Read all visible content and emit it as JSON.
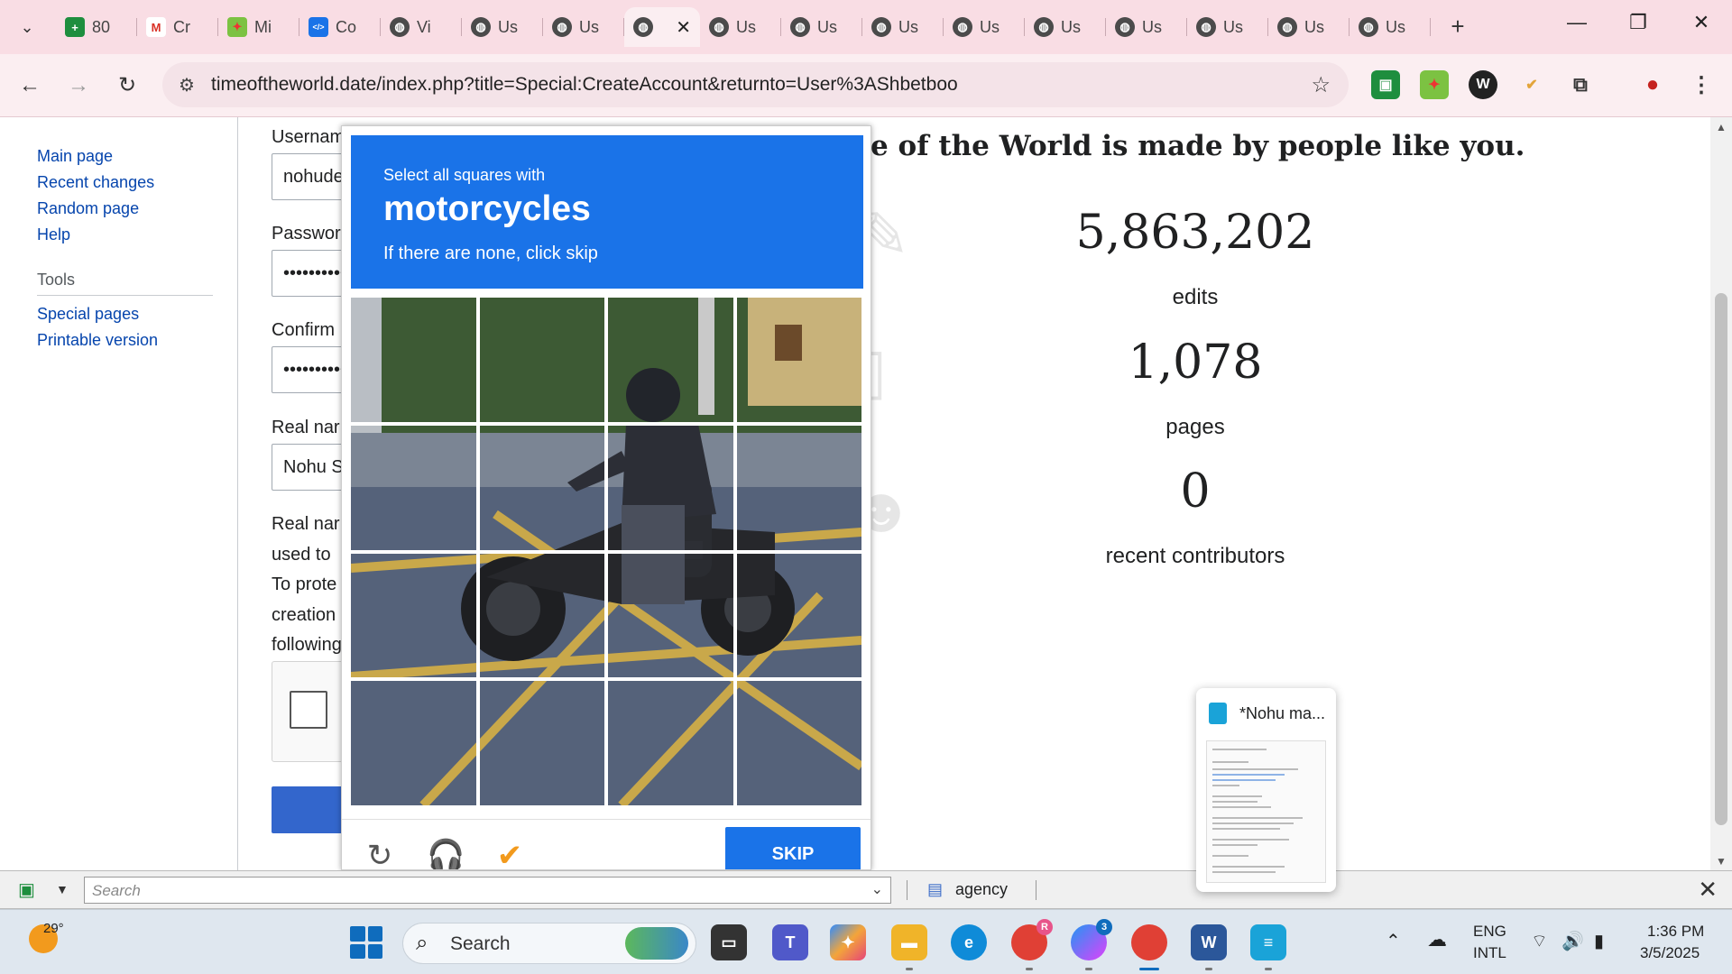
{
  "browser": {
    "tabs": [
      {
        "label": "80",
        "icon": "sheets-icon"
      },
      {
        "label": "Cr",
        "icon": "gmail-icon"
      },
      {
        "label": "Mi",
        "icon": "extension-icon"
      },
      {
        "label": "Co",
        "icon": "code-icon"
      },
      {
        "label": "Vi",
        "icon": "globe-icon"
      },
      {
        "label": "Us",
        "icon": "globe-icon"
      },
      {
        "label": "Us",
        "icon": "globe-icon"
      },
      {
        "label": "",
        "icon": "globe-icon",
        "active": true
      },
      {
        "label": "Us",
        "icon": "globe-icon"
      },
      {
        "label": "Us",
        "icon": "globe-icon"
      },
      {
        "label": "Us",
        "icon": "globe-icon"
      },
      {
        "label": "Us",
        "icon": "globe-icon"
      },
      {
        "label": "Us",
        "icon": "globe-icon"
      },
      {
        "label": "Us",
        "icon": "globe-icon"
      },
      {
        "label": "Us",
        "icon": "globe-icon"
      },
      {
        "label": "Us",
        "icon": "globe-icon"
      },
      {
        "label": "Us",
        "icon": "globe-icon"
      }
    ],
    "url": "timeoftheworld.date/index.php?title=Special:CreateAccount&returnto=User%3AShbetboo"
  },
  "sidebar": {
    "nav": [
      "Main page",
      "Recent changes",
      "Random page",
      "Help"
    ],
    "tools_heading": "Tools",
    "tools": [
      "Special pages",
      "Printable version"
    ]
  },
  "form": {
    "username_label": "Usernam",
    "username_value": "nohude",
    "password_label": "Passwor",
    "password_value": "••••••••••",
    "confirm_label": "Confirm",
    "confirm_value": "••••••••••",
    "realname_label": "Real nar",
    "realname_value": "Nohu S",
    "help_lines": [
      "Real nar",
      "used to",
      "To prote",
      "creation",
      "following"
    ]
  },
  "stats": {
    "title": "e of the World is made by people like you.",
    "edits_value": "5,863,202",
    "edits_label": "edits",
    "pages_value": "1,078",
    "pages_label": "pages",
    "contributors_value": "0",
    "contributors_label": "recent contributors"
  },
  "captcha": {
    "instruction": "Select all squares with",
    "target": "motorcycles",
    "hint": "If there are none, click skip",
    "skip_label": "SKIP"
  },
  "findbar": {
    "search_placeholder": "Search",
    "tab_label": "agency"
  },
  "notepad_preview": {
    "title": "*Nohu ma..."
  },
  "taskbar": {
    "temperature": "29°",
    "search_placeholder": "Search",
    "chrome_badge": "R",
    "messenger_badge": "3",
    "lang_1": "ENG",
    "lang_2": "INTL",
    "time": "1:36 PM",
    "date": "3/5/2025"
  },
  "colors": {
    "captcha_blue": "#1a73e8",
    "link_blue": "#0645ad",
    "tabstrip_pink": "#f9dde4"
  }
}
